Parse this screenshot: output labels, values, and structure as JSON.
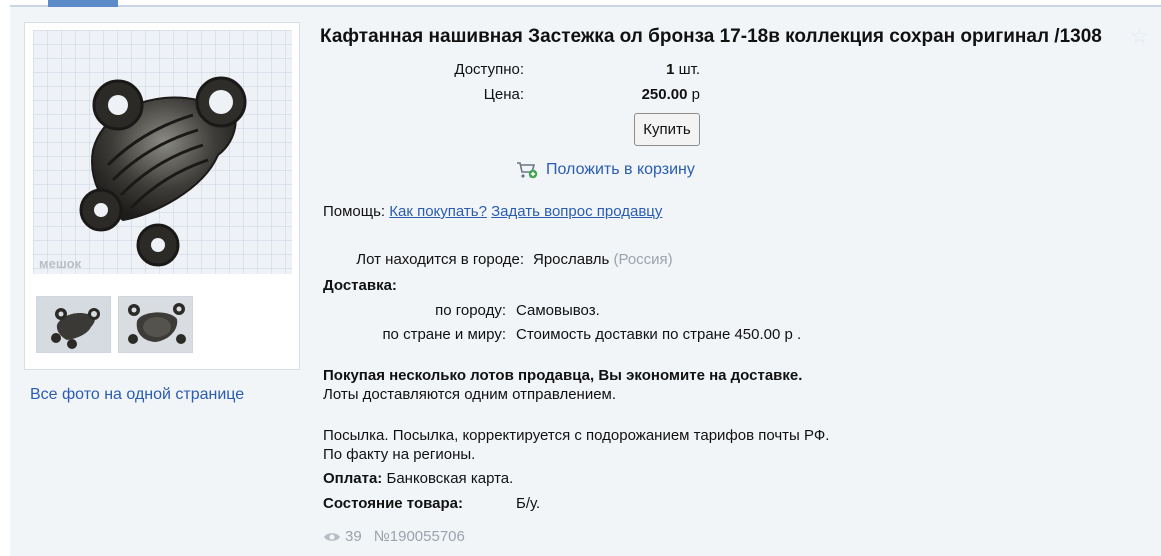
{
  "gallery": {
    "all_photos_link": "Все фото на одной странице",
    "watermark": "мешок"
  },
  "lot": {
    "title": "Кафтанная нашивная Застежка ол бронза 17-18в коллекция сохран оригинал /1308",
    "available_label": "Доступно:",
    "available_qty": "1",
    "available_unit": "шт.",
    "price_label": "Цена:",
    "price_value": "250.00",
    "price_currency": "р",
    "buy_button": "Купить",
    "cart_link": "Положить в корзину"
  },
  "help": {
    "label": "Помощь:",
    "how_to_buy": "Как покупать?",
    "ask_seller": "Задать вопрос продавцу"
  },
  "location": {
    "label": "Лот находится в городе:",
    "city": "Ярославль",
    "country": "(Россия)"
  },
  "delivery": {
    "heading": "Доставка:",
    "city_label": "по городу:",
    "city_value": "Самовывоз.",
    "country_label": "по стране и миру:",
    "country_value": "Стоимость доставки по стране 450.00 р ."
  },
  "notes": {
    "bold_line": "Покупая несколько лотов продавца, Вы экономите на доставке.",
    "line2": "Лоты доставляются одним отправлением.",
    "line3": "Посылка. Посылка, корректируется с подорожанием тарифов почты РФ.",
    "line4": "По факту на регионы."
  },
  "payment": {
    "label": "Оплата:",
    "value": "Банковская карта."
  },
  "condition": {
    "label": "Состояние товара:",
    "value": "Б/у."
  },
  "stats": {
    "views": "39",
    "lot_number": "№190055706"
  },
  "colors": {
    "link": "#2a5db0",
    "muted": "#9aa3ad",
    "panel_bg": "#f2f5f8"
  }
}
